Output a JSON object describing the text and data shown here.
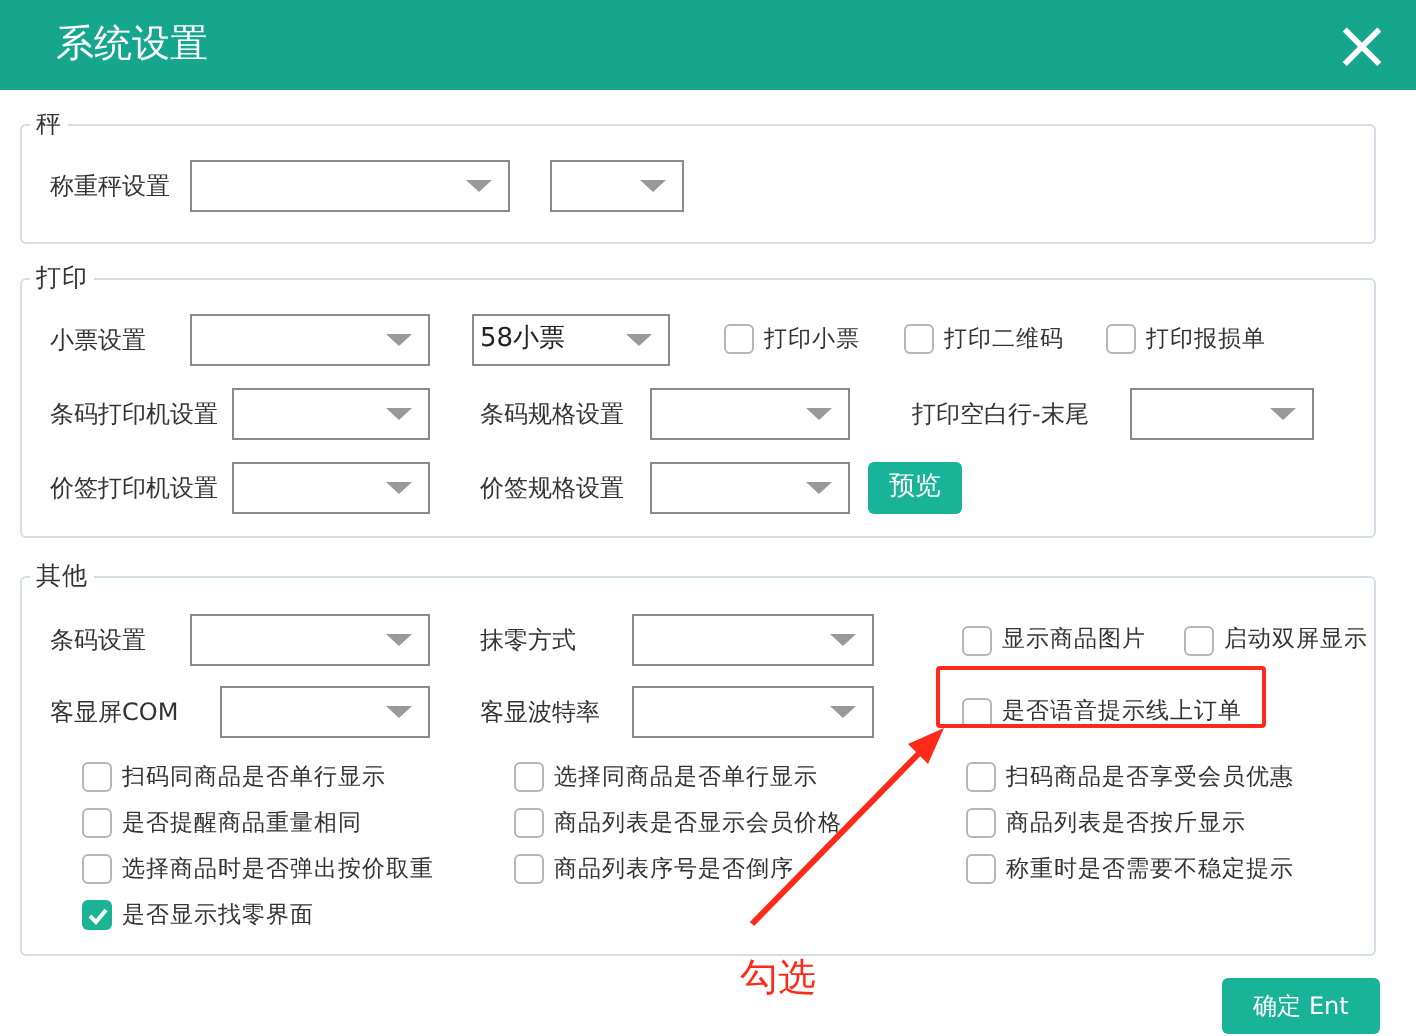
{
  "window": {
    "title": "系统设置",
    "close": "×"
  },
  "sections": [
    {
      "title": "秤",
      "rows": [
        [
          {
            "kind": "label",
            "text": "称重秤设置"
          },
          {
            "kind": "select"
          },
          {
            "kind": "select"
          }
        ]
      ]
    },
    {
      "title": "打印",
      "rows": [
        [
          {
            "kind": "label",
            "text": "小票设置"
          },
          {
            "kind": "select"
          },
          {
            "kind": "select",
            "value": "58小票"
          },
          {
            "kind": "checkbox",
            "text": "打印小票",
            "checked": false
          },
          {
            "kind": "checkbox",
            "text": "打印二维码",
            "checked": false
          },
          {
            "kind": "checkbox",
            "text": "打印报损单",
            "checked": false
          }
        ],
        [
          {
            "kind": "label",
            "text": "条码打印机设置"
          },
          {
            "kind": "select"
          },
          {
            "kind": "label",
            "text": "条码规格设置"
          },
          {
            "kind": "select"
          },
          {
            "kind": "label",
            "text": "打印空白行-末尾"
          },
          {
            "kind": "select"
          }
        ],
        [
          {
            "kind": "label",
            "text": "价签打印机设置"
          },
          {
            "kind": "select"
          },
          {
            "kind": "label",
            "text": "价签规格设置"
          },
          {
            "kind": "select"
          },
          {
            "kind": "button",
            "text": "预览"
          }
        ]
      ]
    },
    {
      "title": "其他",
      "rows": [
        [
          {
            "kind": "label",
            "text": "条码设置"
          },
          {
            "kind": "select"
          },
          {
            "kind": "label",
            "text": "抹零方式"
          },
          {
            "kind": "select"
          },
          {
            "kind": "checkbox",
            "text": "显示商品图片",
            "checked": false
          },
          {
            "kind": "checkbox",
            "text": "启动双屏显示",
            "checked": false
          }
        ],
        [
          {
            "kind": "label",
            "text": "客显屏COM"
          },
          {
            "kind": "select"
          },
          {
            "kind": "label",
            "text": "客显波特率"
          },
          {
            "kind": "select"
          },
          {
            "kind": "checkbox",
            "text": "是否语音提示线上订单",
            "checked": false
          }
        ],
        [
          {
            "kind": "checkbox",
            "text": "扫码同商品是否单行显示",
            "checked": false
          },
          {
            "kind": "checkbox",
            "text": "选择同商品是否单行显示",
            "checked": false
          },
          {
            "kind": "checkbox",
            "text": "扫码商品是否享受会员优惠",
            "checked": false
          }
        ],
        [
          {
            "kind": "checkbox",
            "text": "是否提醒商品重量相同",
            "checked": false
          },
          {
            "kind": "checkbox",
            "text": "商品列表是否显示会员价格",
            "checked": false
          },
          {
            "kind": "checkbox",
            "text": "商品列表是否按斤显示",
            "checked": false
          }
        ],
        [
          {
            "kind": "checkbox",
            "text": "选择商品时是否弹出按价取重",
            "checked": false
          },
          {
            "kind": "checkbox",
            "text": "商品列表序号是否倒序",
            "checked": false
          },
          {
            "kind": "checkbox",
            "text": "称重时是否需要不稳定提示",
            "checked": false
          }
        ],
        [
          {
            "kind": "checkbox",
            "text": "是否显示找零界面",
            "checked": true
          }
        ]
      ]
    }
  ],
  "confirm_button": "确定 Ent",
  "annotation": {
    "text": "勾选"
  }
}
